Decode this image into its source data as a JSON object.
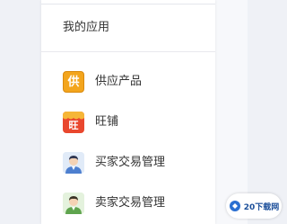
{
  "section": {
    "title": "我的应用"
  },
  "menu": {
    "items": [
      {
        "label": "供应产品",
        "icon": "supply-product-icon",
        "icon_glyph": "供",
        "color": "#f2a41f"
      },
      {
        "label": "旺铺",
        "icon": "shop-icon",
        "icon_glyph": "旺",
        "color": "#e8482f"
      },
      {
        "label": "买家交易管理",
        "icon": "buyer-avatar-icon",
        "color": "#5a8bd6"
      },
      {
        "label": "卖家交易管理",
        "icon": "seller-avatar-icon",
        "color": "#6cae5a"
      }
    ]
  },
  "watermark": {
    "text": "20下载网"
  }
}
